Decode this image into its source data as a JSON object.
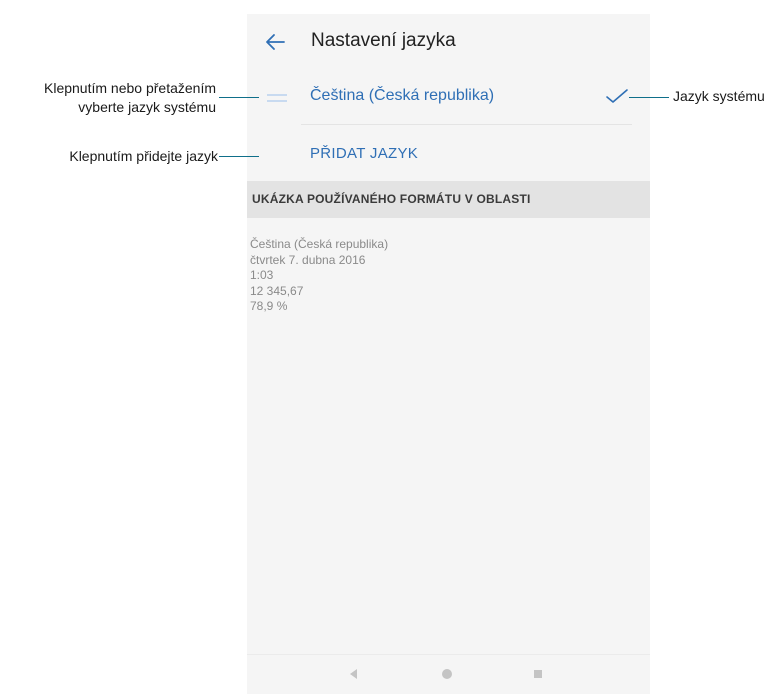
{
  "header": {
    "back_icon": "arrow-left-icon",
    "title": "Nastavení jazyka"
  },
  "language_list": {
    "items": [
      {
        "label": "Čeština (Česká republika)",
        "selected": true,
        "drag_icon": "drag-handle-icon",
        "check_icon": "check-icon"
      }
    ],
    "add_label": "PŘIDAT JAZYK"
  },
  "format_section": {
    "header": "UKÁZKA POUŽÍVANÉHO FORMÁTU V OBLASTI",
    "lines": [
      "Čeština (Česká republika)",
      "čtvrtek 7. dubna 2016",
      "1:03",
      "12 345,67",
      "78,9 %"
    ]
  },
  "navbar": {
    "back_icon": "triangle-back-icon",
    "home_icon": "circle-home-icon",
    "recents_icon": "square-recents-icon"
  },
  "annotations": {
    "drag_callout_line1": "Klepnutím nebo přetažením",
    "drag_callout_line2": "vyberte jazyk systému",
    "add_callout": "Klepnutím přidejte jazyk",
    "system_callout": "Jazyk systému"
  },
  "colors": {
    "accent": "#2f6fb5",
    "leader": "#0f6f8a",
    "screen_bg": "#f5f5f5",
    "section_bg": "#e3e3e3"
  }
}
